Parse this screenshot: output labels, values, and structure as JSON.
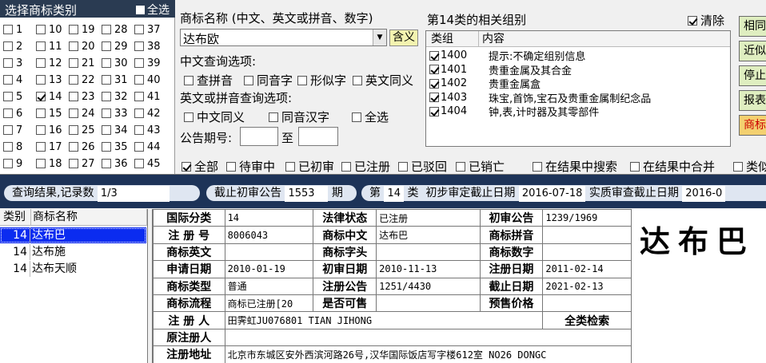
{
  "category_panel": {
    "title": "选择商标类别",
    "select_all": "全选",
    "columns": [
      [
        "1",
        "2",
        "3",
        "4",
        "5",
        "6",
        "7",
        "8",
        "9"
      ],
      [
        "10",
        "11",
        "12",
        "13",
        "14",
        "15",
        "16",
        "17",
        "18"
      ],
      [
        "19",
        "20",
        "21",
        "22",
        "23",
        "24",
        "25",
        "26",
        "27"
      ],
      [
        "28",
        "29",
        "30",
        "31",
        "32",
        "33",
        "34",
        "35",
        "36"
      ],
      [
        "37",
        "38",
        "39",
        "40",
        "41",
        "42",
        "43",
        "44",
        "45"
      ]
    ],
    "checked": "14"
  },
  "name_section": {
    "label": "商标名称 (中文、英文或拼音、数字)",
    "value": "达布欧",
    "meaning_button": "含义",
    "cn_options_label": "中文查询选项:",
    "cn_options": [
      "查拼音",
      "同音字",
      "形似字",
      "英文同义"
    ],
    "en_options_label": "英文或拼音查询选项:",
    "en_options": [
      "中文同义",
      "同音汉字",
      "全选"
    ],
    "pub_label": "公告期号:",
    "to_label": "至"
  },
  "groups": {
    "title": "第14类的相关组别",
    "clear_label": "清除",
    "col_group": "类组",
    "col_content": "内容",
    "rows": [
      {
        "code": "1400",
        "text": "提示:不确定组别信息"
      },
      {
        "code": "1401",
        "text": "贵重金属及其合金"
      },
      {
        "code": "1402",
        "text": "贵重金属盒"
      },
      {
        "code": "1403",
        "text": "珠宝,首饰,宝石及贵重金属制纪念品"
      },
      {
        "code": "1404",
        "text": "钟,表,计时器及其零部件"
      }
    ]
  },
  "right_buttons": [
    "相同",
    "近似",
    "停止",
    "报表",
    "商标"
  ],
  "filters": {
    "items": [
      "全部",
      "待审中",
      "已初审",
      "已注册",
      "已驳回",
      "已销亡",
      "在结果中搜索",
      "在结果中合并",
      "类似"
    ]
  },
  "status": {
    "results_label": "查询结果,记录数",
    "results_value": "1/3",
    "cutoff_label": "截止初审公告",
    "cutoff_value": "1553",
    "cutoff_unit": "期",
    "class_prefix": "第",
    "class_value": "14",
    "class_suffix": "类",
    "prelim_label": "初步审定截止日期",
    "prelim_date": "2016-07-18",
    "substantive_label": "实质审查截止日期",
    "substantive_date": "2016-0"
  },
  "results": {
    "col_class": "类别",
    "col_name": "商标名称",
    "rows": [
      {
        "cls": "14",
        "name": "达布巴"
      },
      {
        "cls": "14",
        "name": "达布施"
      },
      {
        "cls": "14",
        "name": "达布天顺"
      }
    ]
  },
  "detail": {
    "intl_class_k": "国际分类",
    "intl_class_v": "14",
    "legal_status_k": "法律状态",
    "legal_status_v": "已注册",
    "first_pub_k": "初审公告",
    "first_pub_v": "1239/1969",
    "reg_no_k": "注 册 号",
    "reg_no_v": "8006043",
    "name_cn_k": "商标中文",
    "name_cn_v": "达布巴",
    "pinyin_k": "商标拼音",
    "pinyin_v": "",
    "name_en_k": "商标英文",
    "name_en_v": "",
    "initial_k": "商标字头",
    "initial_v": "",
    "digits_k": "商标数字",
    "digits_v": "",
    "apply_date_k": "申请日期",
    "apply_date_v": "2010-01-19",
    "first_date_k": "初审日期",
    "first_date_v": "2010-11-13",
    "reg_date_k": "注册日期",
    "reg_date_v": "2011-02-14",
    "type_k": "商标类型",
    "type_v": "普通",
    "reg_pub_k": "注册公告",
    "reg_pub_v": "1251/4430",
    "expire_k": "截止日期",
    "expire_v": "2021-02-13",
    "flow_k": "商标流程",
    "flow_v": "商标已注册[20",
    "sellable_k": "是否可售",
    "sellable_v": "",
    "presale_k": "预售价格",
    "presale_v": "",
    "registrant_k": "注 册 人",
    "registrant_v": "田霁虹JU076801 TIAN JIHONG",
    "all_class_search": "全类检索",
    "orig_registrant_k": "原注册人",
    "orig_registrant_v": "",
    "address_k": "注册地址",
    "address_v": "北京市东城区安外西滨河路26号,汉华国际饭店写字楼612室 NO26 DONGC"
  },
  "logo": {
    "text": "达布巴"
  }
}
